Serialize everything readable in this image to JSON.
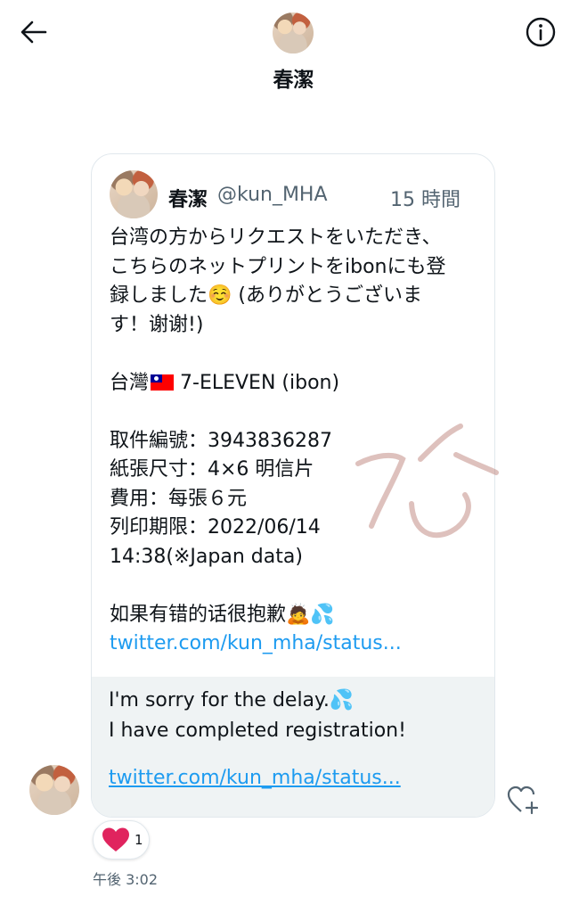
{
  "header": {
    "title": "春潔",
    "back_icon": "arrow-left-icon",
    "info_icon": "info-icon"
  },
  "quoted_tweet": {
    "name": "春潔",
    "handle": "@kun_MHA",
    "time": "15 時間",
    "lines": [
      "台湾の方からリクエストをいただき、",
      "こちらのネットプリントをibonにも登",
      "録しました",
      "(ありがとうございま",
      "す！谢谢!)",
      "台灣",
      " 7-ELEVEN (ibon)",
      "取件編號：3943836287",
      "紙張尺寸：4×6 明信片",
      "費用：每張６元",
      "列印期限：2022/06/14",
      "14:38(※Japan data)",
      "如果有错的话很抱歉",
      "twitter.com/kun_mha/status..."
    ],
    "emoji_smile": "☺️",
    "emoji_bow": "🙇",
    "emoji_drops": "💦"
  },
  "reply": {
    "line1": "I'm sorry for the delay.",
    "line2": "I have completed registration!",
    "link": "twitter.com/kun_mha/status...",
    "emoji_drops": "💦"
  },
  "reaction": {
    "emoji": "❤️",
    "count": "1"
  },
  "timestamp": "午後 3:02",
  "colors": {
    "accent": "#1d9bf0",
    "secondary_text": "#536471",
    "reply_bg": "#eff3f4",
    "heart": "#f91880"
  }
}
